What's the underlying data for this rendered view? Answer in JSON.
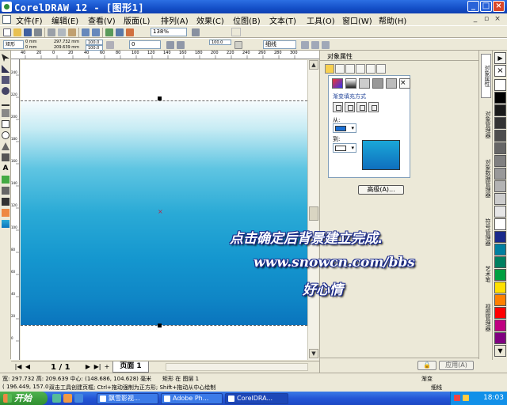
{
  "window": {
    "title": "CorelDRAW 12 - [图形1]",
    "controls": [
      "_",
      "□",
      "×"
    ]
  },
  "menu": {
    "items": [
      "文件(F)",
      "编辑(E)",
      "查看(V)",
      "版面(L)",
      "排列(A)",
      "效果(C)",
      "位图(B)",
      "文本(T)",
      "工具(O)",
      "窗口(W)",
      "帮助(H)"
    ]
  },
  "toolbar": {
    "zoom": "138%",
    "fields": {
      "x": "0 mm",
      "y": "0 mm",
      "width": "297.732 mm",
      "height": "209.639 mm",
      "scale_x": "100.0",
      "scale_y": "100.0",
      "rotation": "0",
      "corner": "100.0",
      "outline": "细线"
    }
  },
  "object_properties": {
    "title": "对象属性",
    "section": "渐变填充方式",
    "from_label": "从:",
    "to_label": "到:",
    "from_color": "#1a6fd4",
    "to_color": "#ffffff",
    "advanced_button": "高级(A)...",
    "apply_button": "应用(A)"
  },
  "side_tabs": [
    "对象属性",
    "对象管理器",
    "对象数据管理器",
    "符号管理器",
    "艺术笔",
    "视图管理器"
  ],
  "page_nav": {
    "count": "1 / 1",
    "tab": "页面 1"
  },
  "status": {
    "size": "宽: 297.732  高: 209.639  中心: (148.686, 104.628)  毫米",
    "object": "矩形 在 图层 1",
    "coords": "( 196.449, 157.0...",
    "hint": "双击工具创建页框; Ctrl+拖动强制为正方形; Shift+拖动从中心绘制",
    "fill": "渐变",
    "outline": "细线"
  },
  "overlay": {
    "line1": "点击确定后背景建立完成.",
    "line2": "www.snowcn.com/bbs",
    "line3": "好心情"
  },
  "taskbar": {
    "start": "开始",
    "tasks": [
      "飘雪影视...",
      "Adobe Ph...",
      "CorelDRA..."
    ],
    "clock": "18:03"
  },
  "ruler": {
    "top_ticks": [
      "40",
      "20",
      "0",
      "20",
      "40",
      "60",
      "80",
      "100",
      "120",
      "140",
      "160",
      "180",
      "200",
      "220",
      "240",
      "260",
      "280",
      "300"
    ],
    "left_ticks": [
      "240",
      "220",
      "200",
      "180",
      "160",
      "140",
      "120",
      "100",
      "80",
      "60",
      "40",
      "20",
      "0"
    ]
  },
  "palette_colors": [
    "#ffffff",
    "#000000",
    "#1a1a1a",
    "#333333",
    "#4d4d4d",
    "#666666",
    "#808080",
    "#999999",
    "#b3b3b3",
    "#cccccc",
    "#e6e6e6",
    "#ffffff",
    "#1a2a8a",
    "#0080a0",
    "#008060",
    "#00a040",
    "#ffe000",
    "#ff8000",
    "#ff0000",
    "#c00080",
    "#800080",
    "#4040c0"
  ]
}
